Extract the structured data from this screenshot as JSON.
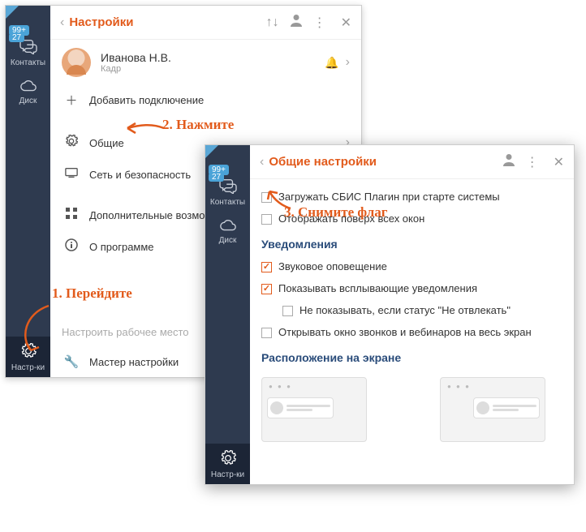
{
  "badges": {
    "top": "99+",
    "contacts": "27"
  },
  "nav": {
    "contacts": "Контакты",
    "disk": "Диск",
    "settings": "Настр-ки"
  },
  "w1": {
    "title": "Настройки",
    "user": {
      "name": "Иванова Н.В.",
      "sub": "Кадр"
    },
    "addConn": "Добавить подключение",
    "general": "Общие",
    "network": "Сеть и безопасность",
    "extra": "Дополнительные возможности",
    "about": "О программе",
    "workplace": "Настроить рабочее место",
    "wizard": "Мастер настройки"
  },
  "w2": {
    "title": "Общие настройки",
    "loadOnStart": "Загружать СБИС Плагин при старте системы",
    "alwaysOnTop": "Отображать поверх всех окон",
    "sectionNotif": "Уведомления",
    "sound": "Звуковое оповещение",
    "popup": "Показывать всплывающие уведомления",
    "dnd": "Не показывать, если статус \"Не отвлекать\"",
    "fullscreen": "Открывать окно звонков и вебинаров на весь экран",
    "sectionPos": "Расположение на экране"
  },
  "anno": {
    "a1": "1. Перейдите",
    "a2": "2. Нажмите",
    "a3": "3. Снимите флаг"
  }
}
